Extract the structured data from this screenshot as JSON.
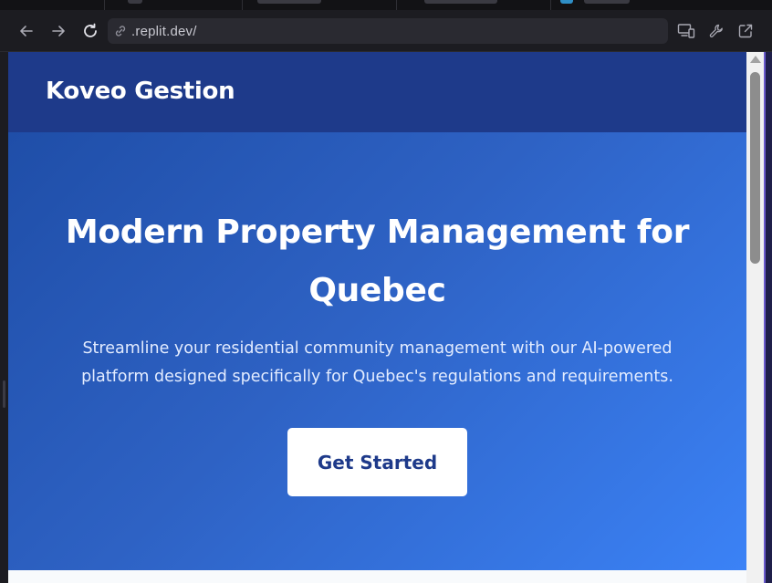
{
  "browser": {
    "url": ".replit.dev/",
    "icons": {
      "back": "arrow-left-icon",
      "forward": "arrow-right-icon",
      "reload": "reload-icon",
      "site_info": "link-icon",
      "devices": "devices-icon",
      "devtools": "wrench-icon",
      "open_external": "open-external-icon"
    }
  },
  "site": {
    "brand": "Koveo Gestion",
    "hero": {
      "title": "Modern Property Management for Quebec",
      "subtitle": "Streamline your residential community management with our AI-powered platform designed specifically for Quebec's regulations and requirements.",
      "cta_label": "Get Started"
    }
  },
  "colors": {
    "header_bg": "#1e3a8a",
    "hero_gradient_start": "#1f4ea8",
    "hero_gradient_end": "#3b82f6",
    "cta_text": "#1e3a8a",
    "browser_chrome": "#1c1c21"
  }
}
